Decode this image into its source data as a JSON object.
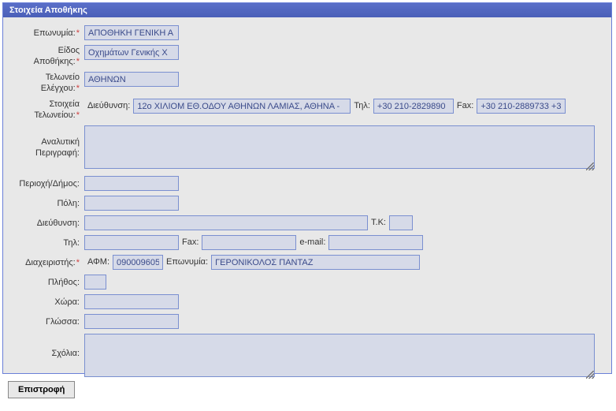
{
  "panel": {
    "title": "Στοιχεία Αποθήκης"
  },
  "labels": {
    "eponymia": "Επωνυμία:",
    "eidosApothikis_l1": "Είδος",
    "eidosApothikis_l2": "Αποθήκης:",
    "teloneioL1": "Τελωνείο",
    "teloneioL2": "Ελέγχου:",
    "stoixeiaL1": "Στοιχεία",
    "stoixeiaL2": "Τελωνείου:",
    "dieythinsi": "Διεύθυνση:",
    "til": "Τηλ:",
    "fax": "Fax:",
    "analytikiL1": "Αναλυτική",
    "analytikiL2": "Περιγραφή:",
    "perioxi": "Περιοχή/Δήμος:",
    "poli": "Πόλη:",
    "dieythinsi2": "Διεύθυνση:",
    "tk": "Τ.Κ:",
    "til2": "Τηλ:",
    "fax2": "Fax:",
    "email": "e-mail:",
    "diaxeiristis": "Διαχειριστής:",
    "afm": "ΑΦΜ:",
    "eponymia2": "Επωνυμία:",
    "plithos": "Πλήθος:",
    "xora": "Χώρα:",
    "glossa": "Γλώσσα:",
    "sxolia": "Σχόλια:"
  },
  "values": {
    "eponymia": "ΑΠΟΘΗΚΗ ΓΕΝΙΚΗ Α",
    "eidosApothikis": "Οχημάτων Γενικής Χ",
    "teloneio": "ΑΘΗΝΩΝ",
    "teloneioAddr": "12ο ΧΙΛΙΟΜ ΕΘ.ΟΔΟΥ ΑΘΗΝΩΝ ΛΑΜΙΑΣ, ΑΘΗΝΑ -",
    "teloneioTil": "+30 210-2829890",
    "teloneioFax": "+30 210-2889733 +3",
    "analytiki": "",
    "perioxi": "",
    "poli": "",
    "addr": "",
    "tk": "",
    "til": "",
    "fax": "",
    "email": "",
    "afm": "090009605",
    "mgrEponymia": "ΓΕΡΟΝΙΚΟΛΟΣ ΠΑΝΤΑΖ",
    "plithos": "",
    "xora": "",
    "glossa": "",
    "sxolia": ""
  },
  "buttons": {
    "back": "Επιστροφή"
  }
}
